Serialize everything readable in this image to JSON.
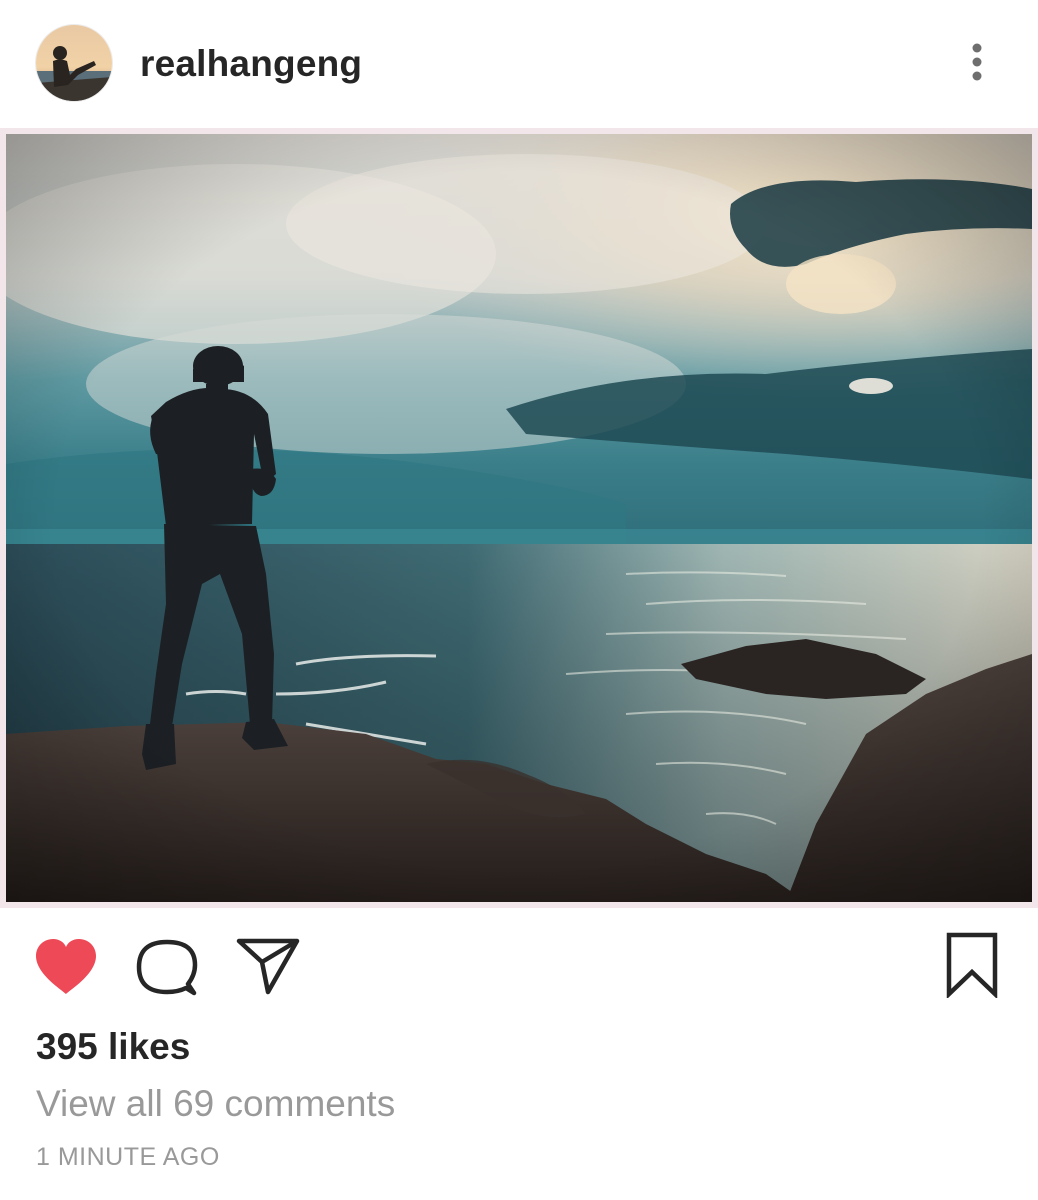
{
  "post": {
    "username": "realhangeng",
    "likes_text": "395 likes",
    "comments_link": "View all 69 comments",
    "timestamp": "1 MINUTE AGO",
    "liked": true
  },
  "icons": {
    "more": "more-vertical-icon",
    "like": "heart-filled-icon",
    "comment": "comment-bubble-icon",
    "share": "paper-plane-icon",
    "save": "bookmark-icon"
  },
  "colors": {
    "text_primary": "#262626",
    "text_secondary": "#999999",
    "like_red": "#ed4956",
    "icon_dark": "#262626"
  }
}
